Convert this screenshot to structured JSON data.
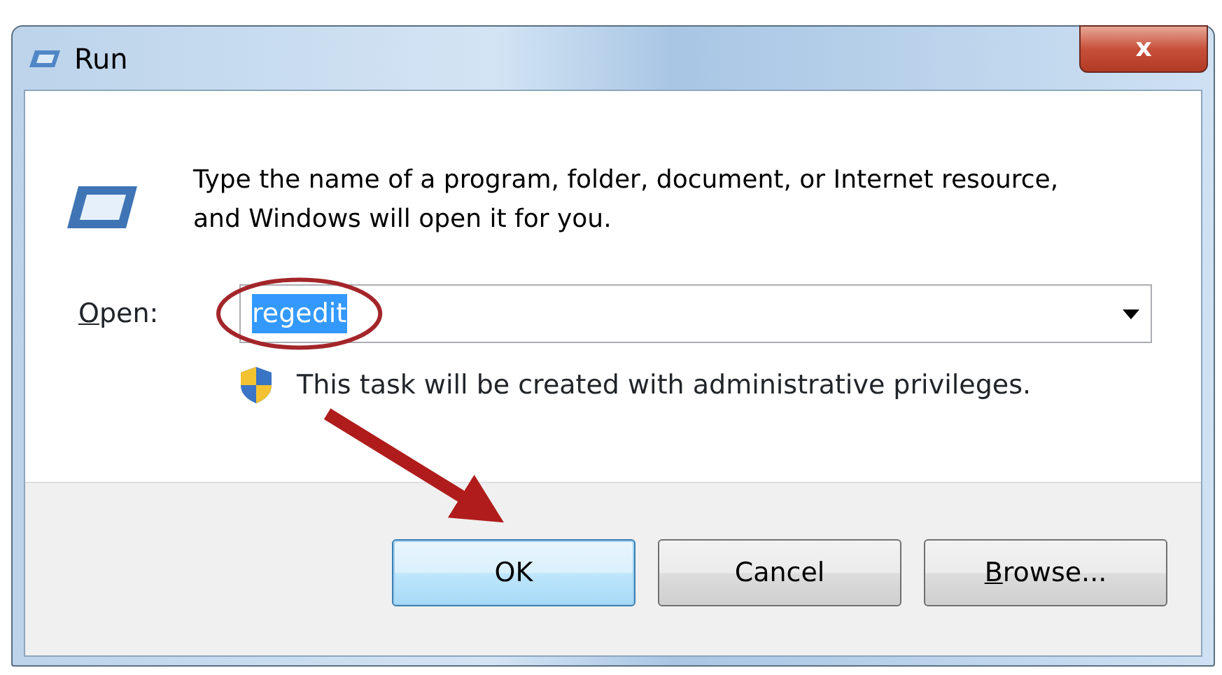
{
  "window": {
    "title": "Run",
    "close_label": "x"
  },
  "message": "Type the name of a program, folder, document, or Internet resource, and Windows will open it for you.",
  "open_field": {
    "label": "Open:",
    "label_mnemonic": true,
    "value": "regedit",
    "value_selected": true
  },
  "admin_note": "This task will be created with administrative privileges.",
  "buttons": [
    {
      "label": "OK",
      "default": true,
      "mnemonic": false
    },
    {
      "label": "Cancel",
      "default": false,
      "mnemonic": false
    },
    {
      "label": "Browse...",
      "default": false,
      "mnemonic": true
    }
  ],
  "annotations": {
    "circle_on_field": true,
    "arrow_to_ok": true
  }
}
